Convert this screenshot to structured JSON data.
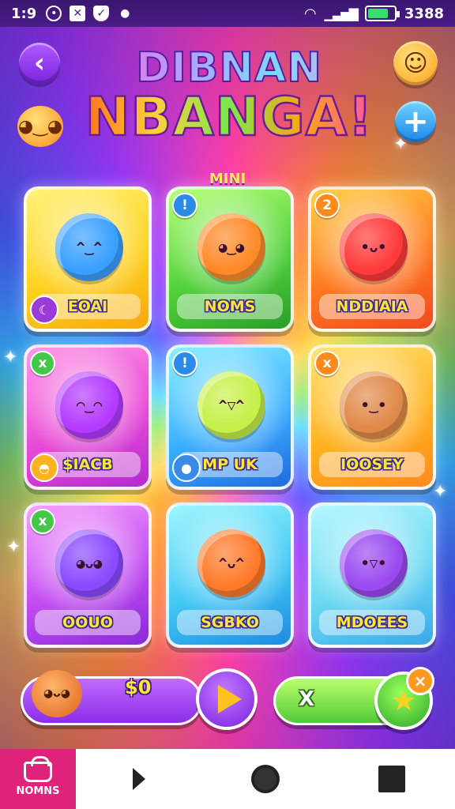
{
  "status_bar": {
    "time": "1:9",
    "icons": [
      "target-icon",
      "notification-box-icon",
      "shield-icon",
      "dot-icon"
    ],
    "battery_percent_label": "3388"
  },
  "header": {
    "title_line1": "DIBNAN",
    "title_line2": "NBANGA!",
    "section_label": "MINI"
  },
  "cards": [
    {
      "label": "EOAI",
      "color": "c-yellow",
      "char_color": "#3aa0ff",
      "badge": null,
      "sub_icon": "moon-icon"
    },
    {
      "label": "NOMS",
      "color": "c-green",
      "char_color": "#ff8a2a",
      "badge": {
        "text": "!",
        "color": "blue"
      },
      "sub_icon": null
    },
    {
      "label": "NDDIAIA",
      "color": "c-orange",
      "char_color": "#ff3a3a",
      "badge": {
        "text": "2",
        "color": "orange"
      },
      "sub_icon": null
    },
    {
      "label": "$IACB",
      "color": "c-pink",
      "char_color": "#b43aff",
      "badge": {
        "text": "x",
        "color": "green"
      },
      "sub_icon": "hat-icon"
    },
    {
      "label": "MP UK",
      "color": "c-blue",
      "char_color": "#c6f04a",
      "badge": {
        "text": "!",
        "color": "blue"
      },
      "sub_icon": "ball-icon"
    },
    {
      "label": "IOOSEY",
      "color": "c-gold",
      "char_color": "#e08a4a",
      "badge": {
        "text": "x",
        "color": "orange"
      },
      "sub_icon": null
    },
    {
      "label": "OOUO",
      "color": "c-purple",
      "char_color": "#8a4aff",
      "badge": {
        "text": "x",
        "color": "green"
      },
      "sub_icon": null
    },
    {
      "label": "SGBKO",
      "color": "c-sky",
      "char_color": "#ff7a2a",
      "badge": null,
      "sub_icon": null
    },
    {
      "label": "MDOEES",
      "color": "c-teal",
      "char_color": "#9a4af0",
      "badge": null,
      "sub_icon": null
    }
  ],
  "controls": {
    "count_label": "$0",
    "right_label": "X",
    "close_label": "×"
  },
  "navbar": {
    "home_label": "NOMNS"
  }
}
